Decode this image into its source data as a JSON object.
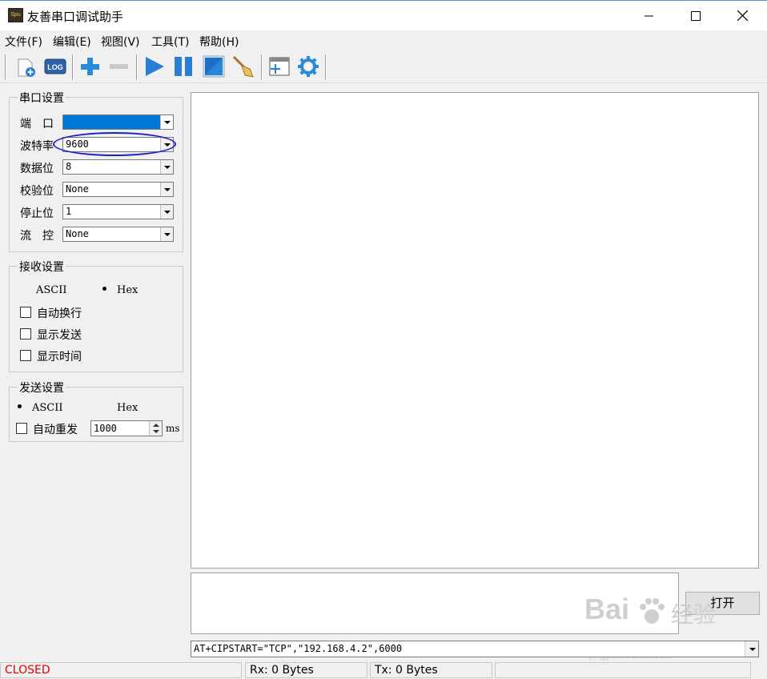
{
  "window": {
    "title": "友善串口调试助手",
    "icon_text": "Spu"
  },
  "menu": [
    "文件(F)",
    "编辑(E)",
    "视图(V)",
    "工具(T)",
    "帮助(H)"
  ],
  "toolbar": {
    "log_label": "LOG",
    "icons": [
      "new-file-icon",
      "log-icon",
      "add-icon",
      "remove-icon",
      "play-icon",
      "pause-icon",
      "stop-icon",
      "clear-broom-icon",
      "new-window-icon",
      "settings-gear-icon"
    ]
  },
  "serial_settings": {
    "title": "串口设置",
    "port_label": "端　口",
    "port_value": "",
    "baud_label": "波特率",
    "baud_value": "9600",
    "databits_label": "数据位",
    "databits_value": "8",
    "parity_label": "校验位",
    "parity_value": "None",
    "stopbits_label": "停止位",
    "stopbits_value": "1",
    "flow_label": "流　控",
    "flow_value": "None"
  },
  "receive_settings": {
    "title": "接收设置",
    "ascii_label": "ASCII",
    "hex_label": "Hex",
    "selected": "Hex",
    "auto_newline_label": "自动换行",
    "show_send_label": "显示发送",
    "show_time_label": "显示时间"
  },
  "send_settings": {
    "title": "发送设置",
    "ascii_label": "ASCII",
    "hex_label": "Hex",
    "selected": "ASCII",
    "auto_resend_label": "自动重发",
    "interval_value": "1000",
    "interval_unit": "ms"
  },
  "send": {
    "open_button": "打开",
    "command_value": "AT+CIPSTART=\"TCP\",\"192.168.4.2\",6000"
  },
  "status": {
    "state": "CLOSED",
    "state_color": "#e00000",
    "rx": "Rx: 0 Bytes",
    "tx": "Tx: 0 Bytes"
  },
  "watermark": {
    "brand": "Bai",
    "brand_cn": "经验",
    "url": "jingyan.baidu.com"
  }
}
